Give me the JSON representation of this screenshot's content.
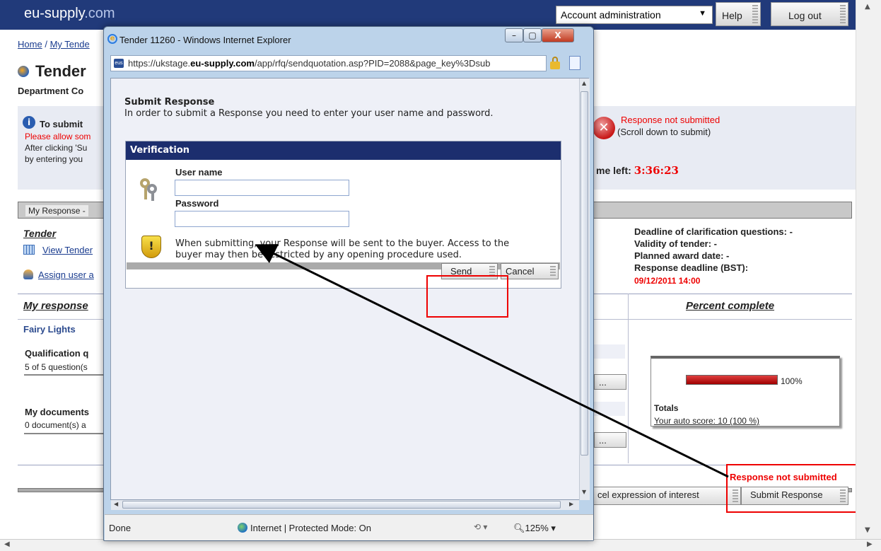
{
  "site": {
    "logo_main": "eu-supply",
    "logo_tld": ".com",
    "account_dropdown": "Account administration",
    "help": "Help",
    "logout": "Log out"
  },
  "page": {
    "breadcrumb_home": "Home",
    "breadcrumb_sep": "/",
    "breadcrumb_next": "My Tende",
    "title": "Tender",
    "department": "Department Co",
    "info_title": "To submit",
    "info_line1": "Please allow som",
    "info_line2": "After clicking 'Su",
    "info_line3": "by entering you",
    "status_red": "Response not submitted",
    "status_note": "(Scroll down to submit)",
    "time_left_label": "me left:",
    "time_left_value": "3:36:23",
    "my_response_tab": "My Response -",
    "tender_heading": "Tender",
    "view_tender": "View Tender",
    "assign_user": "Assign user a",
    "deadline_clarification": "Deadline of clarification questions: -",
    "validity": "Validity of tender: -",
    "planned_award": "Planned award date: -",
    "response_deadline_label": "Response deadline  (BST):",
    "response_deadline_value": "09/12/2011 14:00",
    "my_response_heading": "My response",
    "percent_complete": "Percent complete",
    "lot_name": "Fairy Lights",
    "qualification_label": "Qualification q",
    "qualification_count": "5 of  5 question(s",
    "documents_label": "My documents",
    "documents_count": "0  document(s) a",
    "progress_percent_label": "100%",
    "progress_fraction": 1.0,
    "totals_label": "Totals",
    "auto_score": "Your auto score: 10  (100 %)",
    "dots_button": "...",
    "bottom_status": "Response not submitted",
    "cancel_interest_button": "cel expression of interest",
    "submit_button": "Submit Response"
  },
  "popup": {
    "window_title": "Tender 11260 - Windows Internet Explorer",
    "address_prefix": "https://ukstage.",
    "address_domain": "eu-supply.com",
    "address_rest": "/app/rfq/sendquotation.asp?PID=2088&page_key%3Dsub",
    "submit_heading": "Submit Response",
    "submit_instructions": "In order to submit a Response you need to enter your user name and password.",
    "verification_heading": "Verification",
    "username_label": "User name",
    "username_value": "",
    "password_label": "Password",
    "password_value": "",
    "warning_line1": "When submitting, your Response will be sent to the buyer. Access to the",
    "warning_line2": "buyer may then be restricted by any opening procedure used.",
    "send_button": "Send",
    "cancel_button": "Cancel",
    "status_done": "Done",
    "status_zone": "Internet | Protected Mode: On",
    "zoom": "125%"
  },
  "colors": {
    "brand_navy": "#213a7a",
    "alert_red": "#e00000",
    "highlight_frame": "#e00000",
    "progress_red": "#c00000"
  }
}
